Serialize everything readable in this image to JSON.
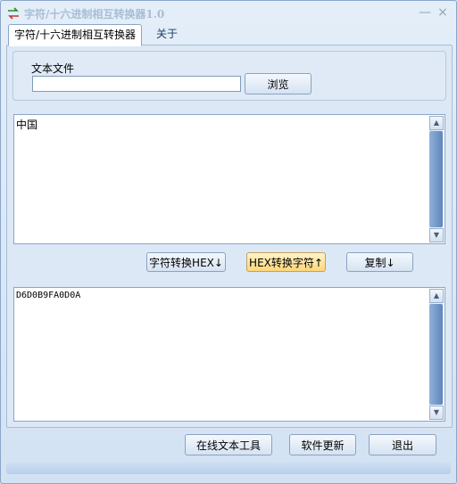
{
  "window": {
    "title": "字符/十六进制相互转换器1.0",
    "minimize_glyph": "—",
    "close_glyph": "×"
  },
  "tabs": [
    {
      "label": "字符/十六进制相互转换器",
      "active": true
    },
    {
      "label": "关于",
      "active": false
    }
  ],
  "file_group": {
    "label": "文本文件",
    "input_value": "",
    "browse_label": "浏览"
  },
  "input_text": "中国",
  "actions": {
    "to_hex_label": "字符转换HEX↓",
    "to_char_label": "HEX转换字符↑",
    "copy_label": "复制↓"
  },
  "output_text": "D6D0B9FA0D0A",
  "footer": {
    "online_tool_label": "在线文本工具",
    "update_label": "软件更新",
    "exit_label": "退出"
  },
  "icons": {
    "scroll_up": "▲",
    "scroll_down": "▼"
  },
  "colors": {
    "accent": "#5f86bb",
    "highlight_button": "#ffd77a"
  }
}
